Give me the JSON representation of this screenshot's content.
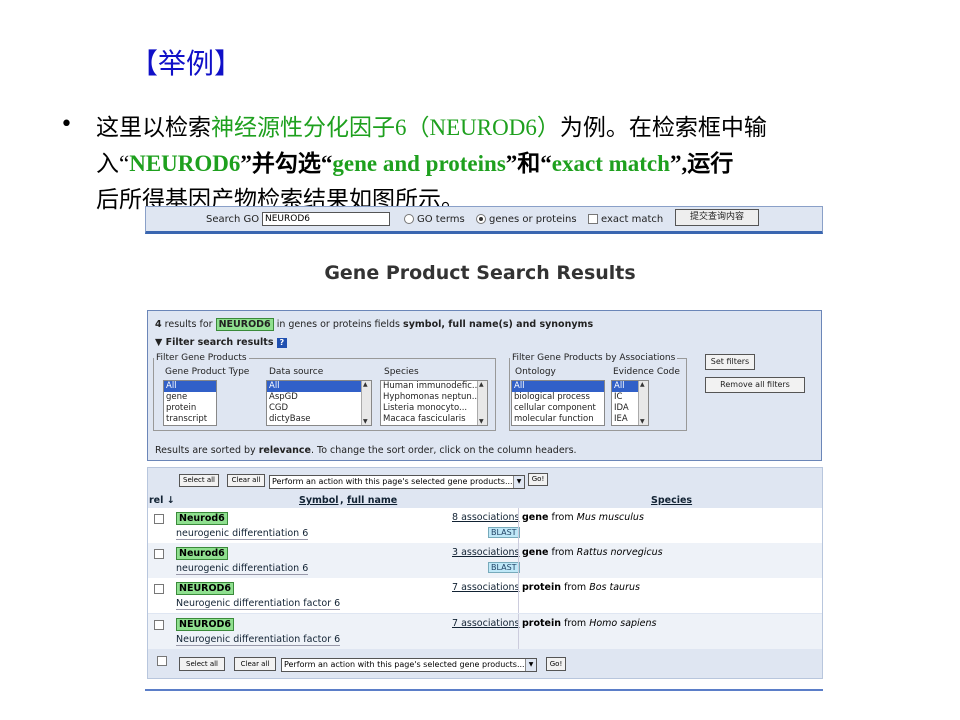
{
  "slide": {
    "title": "【举例】",
    "bullet": "•",
    "line1_a": "这里以检索",
    "line1_b": "神经源性分化因子6（NEUROD6）",
    "line1_c": "为例。在检索框中输",
    "line2_a": "入“",
    "line2_b": "NEUROD6",
    "line2_c": "”并勾选“",
    "line2_d": "gene and proteins",
    "line2_e": "”和“",
    "line2_f": "exact match",
    "line2_g": "”,运行",
    "line3": "后所得基因产物检索结果如图所示。"
  },
  "search": {
    "label": "Search GO",
    "value": "NEUROD6",
    "opt_go": "GO terms",
    "opt_genes": "genes or proteins",
    "opt_exact": "exact match",
    "submit": "提交查询内容"
  },
  "heading": "Gene Product Search Results",
  "filters": {
    "count": "4",
    "results_for": "results for",
    "query": "NEUROD6",
    "in_fields": "in genes or proteins fields",
    "fields": "symbol, full name(s) and synonyms",
    "toggle": "▼ Filter search results",
    "help": "?",
    "group1": "Filter Gene Products",
    "group2": "Filter Gene Products by Associations",
    "col_type": "Gene Product Type",
    "col_source": "Data source",
    "col_species": "Species",
    "col_ontology": "Ontology",
    "col_evidence": "Evidence Code",
    "type_opts": [
      "All",
      "gene",
      "protein",
      "transcript"
    ],
    "source_opts": [
      "All",
      "AspGD",
      "CGD",
      "dictyBase"
    ],
    "species_opts": [
      "Human immunodefic...",
      "Hyphomonas neptun...",
      "Listeria monocyto...",
      "Macaca fascicularis"
    ],
    "ontology_opts": [
      "All",
      "biological process",
      "cellular component",
      "molecular function"
    ],
    "evidence_opts": [
      "All",
      "IC",
      "IDA",
      "IEA"
    ],
    "set_filters": "Set filters",
    "remove_filters": "Remove all filters",
    "sorted_a": "Results are sorted by",
    "sorted_b": "relevance",
    "sorted_c": ". To change the sort order, click on the column headers."
  },
  "results": {
    "select_all": "Select all",
    "clear_all": "Clear all",
    "action_placeholder": "Perform an action with this page's selected gene products...",
    "go": "Go!",
    "col_rel": "rel",
    "col_symbol": "Symbol",
    "col_fullname": "full name",
    "col_species": "Species",
    "rows": [
      {
        "symbol": "Neurod6",
        "fullname": "neurogenic differentiation 6",
        "assoc": "8 associations",
        "blast": "BLAST",
        "kind": "gene",
        "from": "from",
        "species": "Mus musculus"
      },
      {
        "symbol": "Neurod6",
        "fullname": "neurogenic differentiation 6",
        "assoc": "3 associations",
        "blast": "BLAST",
        "kind": "gene",
        "from": "from",
        "species": "Rattus norvegicus"
      },
      {
        "symbol": "NEUROD6",
        "fullname": "Neurogenic differentiation factor 6",
        "assoc": "7 associations",
        "blast": "",
        "kind": "protein",
        "from": "from",
        "species": "Bos taurus"
      },
      {
        "symbol": "NEUROD6",
        "fullname": "Neurogenic differentiation factor 6",
        "assoc": "7 associations",
        "blast": "",
        "kind": "protein",
        "from": "from",
        "species": "Homo sapiens"
      }
    ]
  },
  "colors": {
    "title": "#1010c8",
    "highlight": "#1ea01e",
    "match": "#8fe08f"
  }
}
